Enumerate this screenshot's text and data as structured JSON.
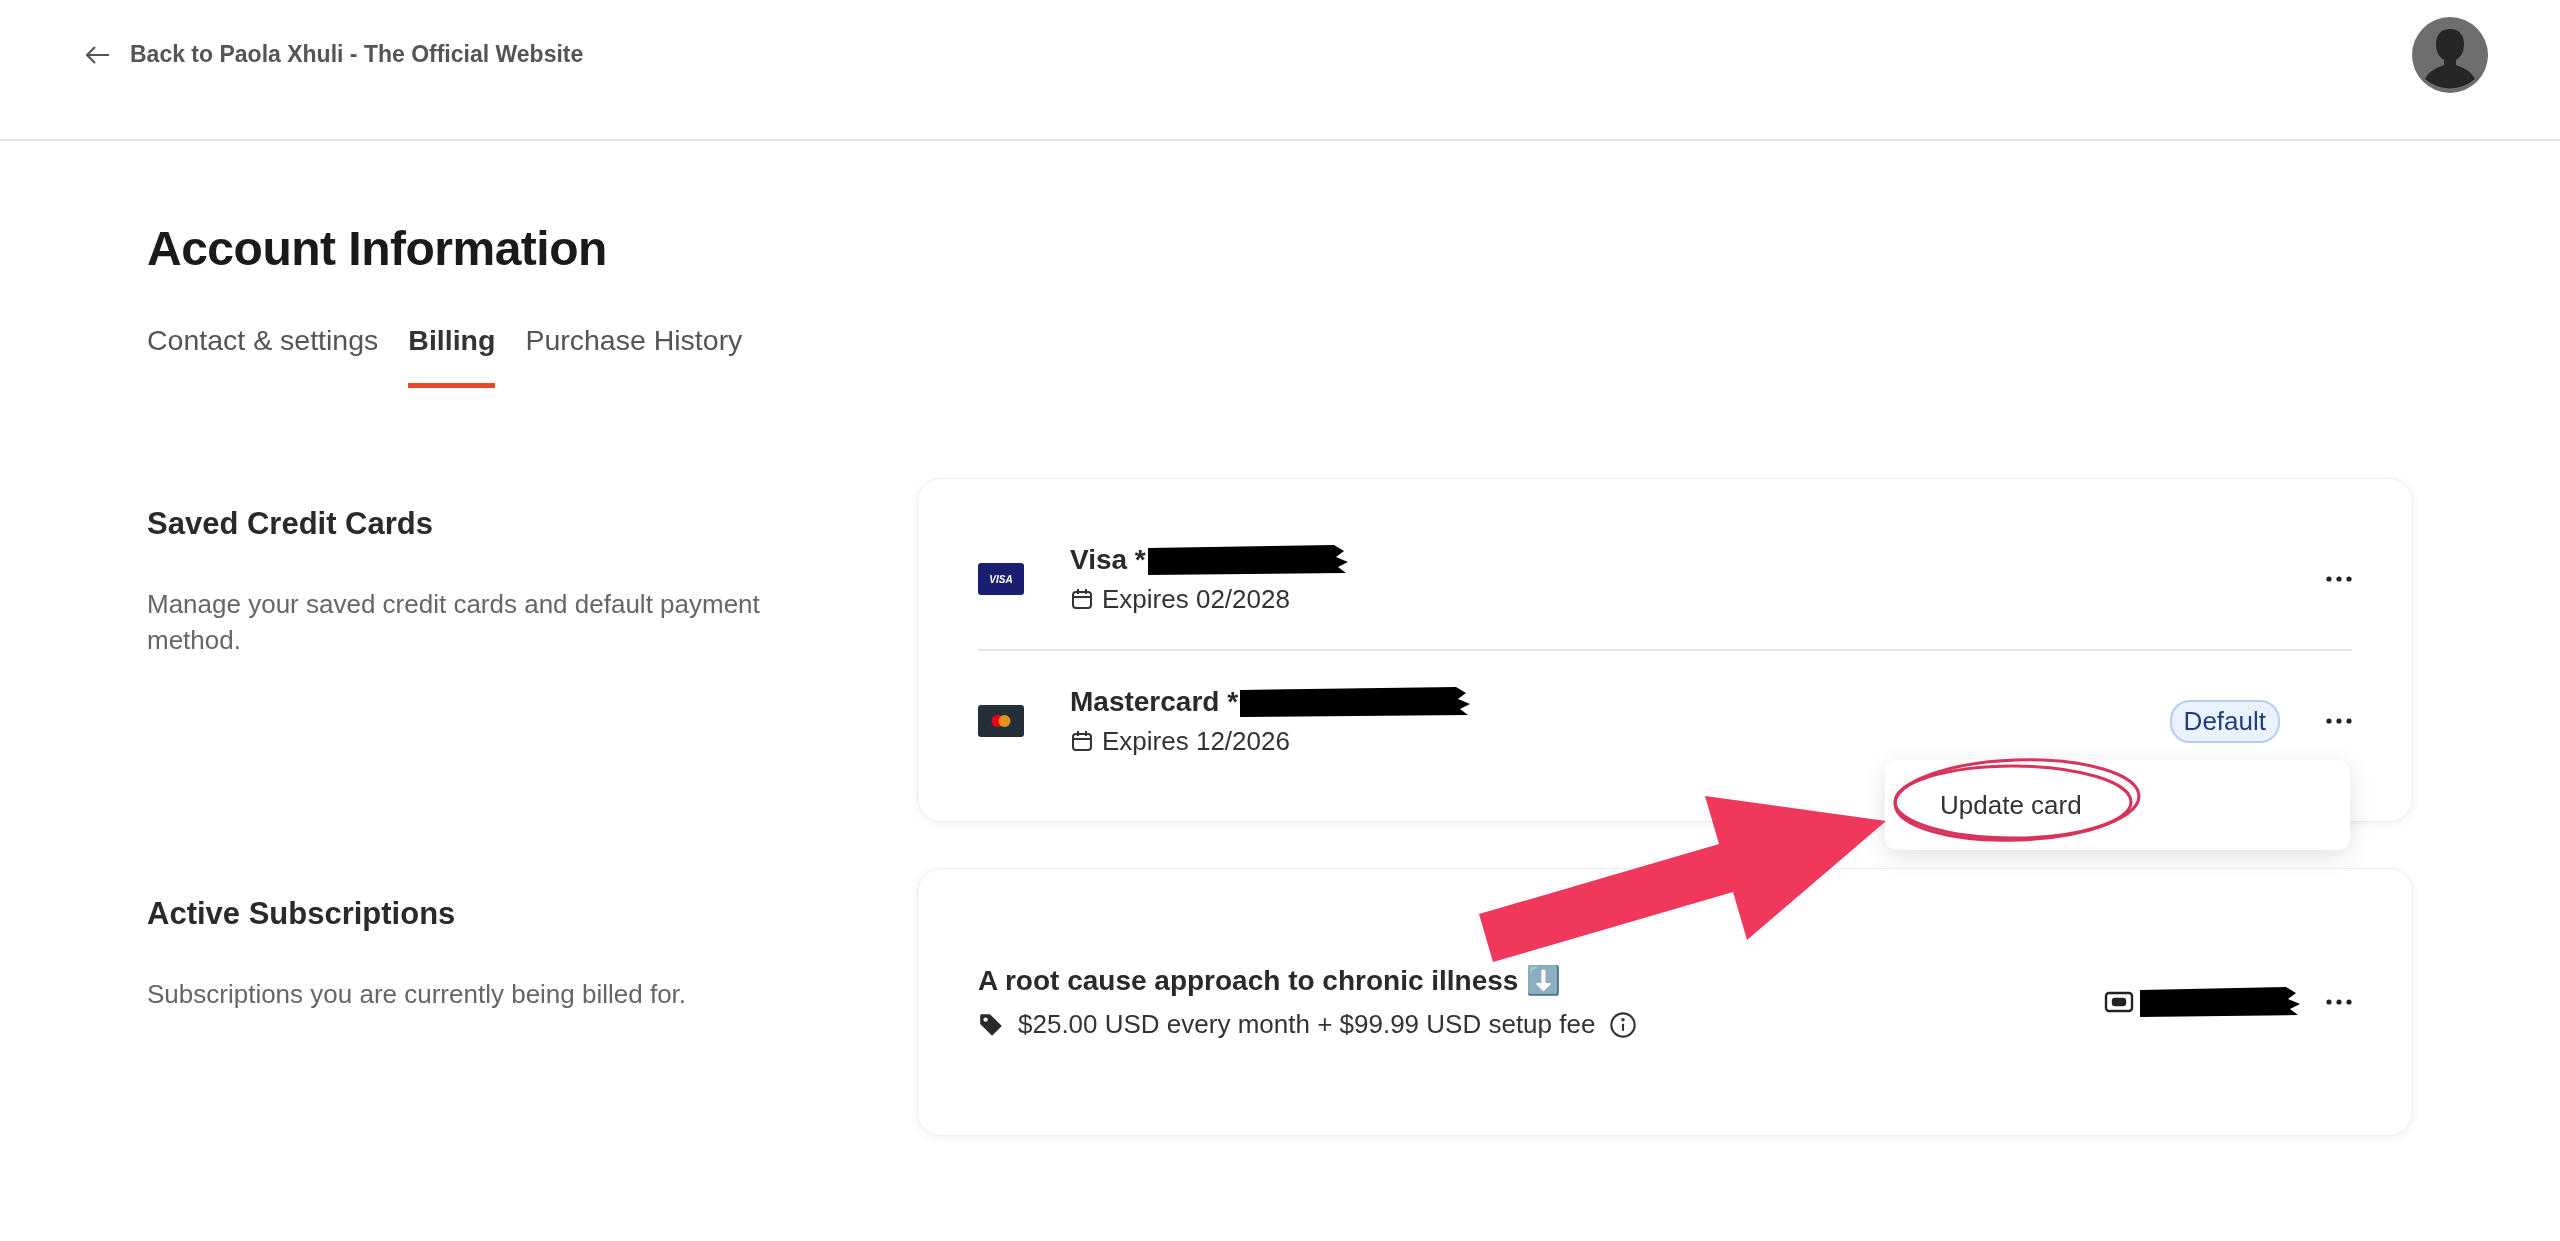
{
  "back_link": {
    "label": "Back to Paola Xhuli - The Official Website"
  },
  "page_title": "Account Information",
  "tabs": [
    {
      "label": "Contact & settings",
      "selected": false
    },
    {
      "label": "Billing",
      "selected": true
    },
    {
      "label": "Purchase History",
      "selected": false
    }
  ],
  "saved_cards": {
    "title": "Saved Credit Cards",
    "description": "Manage your saved credit cards and default payment method.",
    "cards": [
      {
        "kind": "visa",
        "logo_text": "VISA",
        "name": "Visa *",
        "expires": "Expires 02/2028"
      },
      {
        "kind": "mastercard",
        "name": "Mastercard *",
        "expires": "Expires 12/2026",
        "badge": "Default"
      }
    ]
  },
  "card_menu": {
    "items": [
      "Update card"
    ]
  },
  "subscriptions": {
    "title": "Active Subscriptions",
    "description": "Subscriptions you are currently being billed for.",
    "items": [
      {
        "title": "A root cause approach to chronic illness ⬇️",
        "price": "$25.00 USD every month + $99.99 USD setup fee"
      }
    ]
  }
}
